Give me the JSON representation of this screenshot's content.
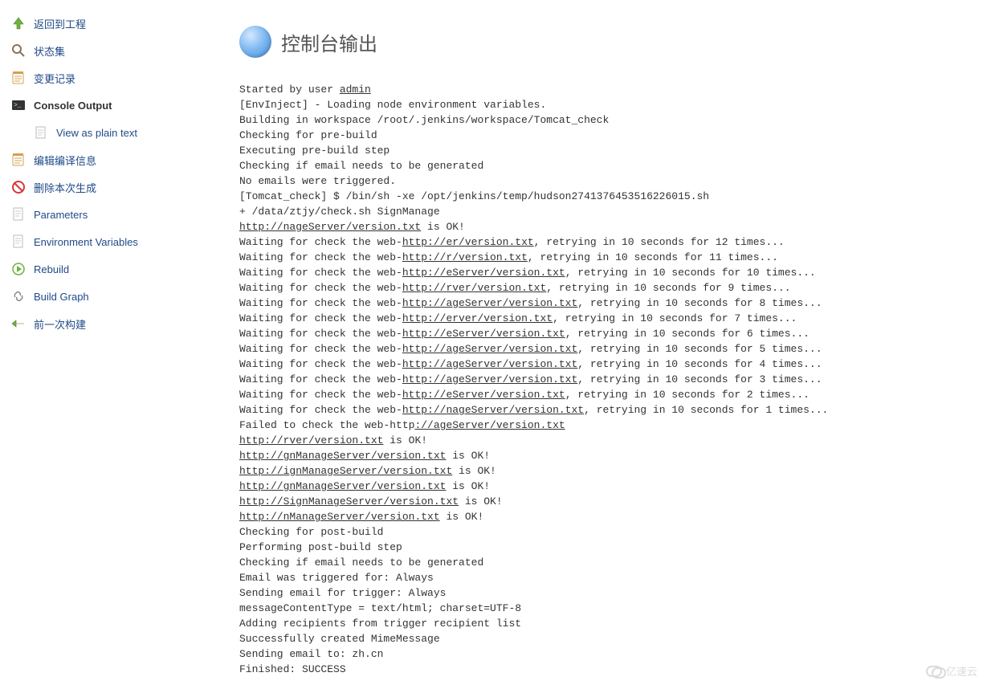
{
  "sidebar": {
    "items": [
      {
        "label": "返回到工程",
        "name": "back-to-project"
      },
      {
        "label": "状态集",
        "name": "status"
      },
      {
        "label": "变更记录",
        "name": "changes"
      },
      {
        "label": "Console Output",
        "name": "console-output",
        "active": true
      },
      {
        "label": "View as plain text",
        "name": "view-plain-text",
        "sub": true
      },
      {
        "label": "编辑编译信息",
        "name": "edit-build-info"
      },
      {
        "label": "删除本次生成",
        "name": "delete-build"
      },
      {
        "label": "Parameters",
        "name": "parameters"
      },
      {
        "label": "Environment Variables",
        "name": "env-vars"
      },
      {
        "label": "Rebuild",
        "name": "rebuild"
      },
      {
        "label": "Build Graph",
        "name": "build-graph"
      },
      {
        "label": "前一次构建",
        "name": "prev-build"
      }
    ]
  },
  "page": {
    "title": "控制台输出"
  },
  "console": {
    "started_by_prefix": "Started by user ",
    "started_by_user": "admin",
    "lines_pre": [
      "[EnvInject] - Loading node environment variables.",
      "Building in workspace /root/.jenkins/workspace/Tomcat_check",
      "Checking for pre-build",
      "Executing pre-build step",
      "Checking if email needs to be generated",
      "No emails were triggered.",
      "[Tomcat_check] $ /bin/sh -xe /opt/jenkins/temp/hudson2741376453516226015.sh",
      "+ /data/ztjy/check.sh SignManage"
    ],
    "first_ok": {
      "prefix": "http://",
      "blur": "                           ",
      "suffix": "nageServer/version.txt",
      "tail": " is OK!"
    },
    "wait_prefix": "Waiting for check the web-",
    "wait_url_prefix": "http://",
    "wait_rows": [
      {
        "blur": "                                         ",
        "suffix": "er/version.txt",
        "tail": ", retrying in 10 seconds for 12 times..."
      },
      {
        "blur": "                                          ",
        "suffix": "r/version.txt",
        "tail": ", retrying in 10 seconds for 11 times..."
      },
      {
        "blur": "                               ",
        "suffix": "eServer/version.txt",
        "tail": ", retrying in 10 seconds for 10 times..."
      },
      {
        "blur": "                                     ",
        "suffix": "rver/version.txt",
        "tail": ", retrying in 10 seconds for 9 times..."
      },
      {
        "blur": "                              ",
        "suffix": "ageServer/version.txt",
        "tail": ", retrying in 10 seconds for 8 times..."
      },
      {
        "blur": "                                 ",
        "suffix": "erver/version.txt",
        "tail": ", retrying in 10 seconds for 7 times..."
      },
      {
        "blur": "                               ",
        "suffix": "eServer/version.txt",
        "tail": ", retrying in 10 seconds for 6 times..."
      },
      {
        "blur": "                              ",
        "suffix": "ageServer/version.txt",
        "tail": ", retrying in 10 seconds for 5 times..."
      },
      {
        "blur": "                              ",
        "suffix": "ageServer/version.txt",
        "tail": ", retrying in 10 seconds for 4 times..."
      },
      {
        "blur": "                              ",
        "suffix": "ageServer/version.txt",
        "tail": ", retrying in 10 seconds for 3 times..."
      },
      {
        "blur": "                                ",
        "suffix": "eServer/version.txt",
        "tail": ", retrying in 10 seconds for 2 times..."
      },
      {
        "blur": "                             ",
        "suffix": "nageServer/version.txt",
        "tail": ", retrying in 10 seconds for 1 times..."
      }
    ],
    "failed": {
      "prefix": "Failed to check the web-http",
      "mid_prefix": "://",
      "blur": "                             ",
      "suffix": "ageServer/version.txt"
    },
    "ok_rows": [
      {
        "prefix": "http://",
        "blur": "                               ",
        "suffix": "rver/version.txt",
        "tail": " is OK!"
      },
      {
        "prefix": "http://",
        "blur": "                     ",
        "suffix": "gnManageServer/version.txt",
        "tail": " is OK!"
      },
      {
        "prefix": "http://",
        "blur": "                     ",
        "suffix": "ignManageServer/version.txt",
        "tail": " is OK!"
      },
      {
        "prefix": "http://",
        "blur": "                      ",
        "suffix": "gnManageServer/version.txt",
        "tail": " is OK!"
      },
      {
        "prefix": "http://",
        "blur": "                     ",
        "suffix": "SignManageServer/version.txt",
        "tail": " is OK!"
      },
      {
        "prefix": "http://",
        "blur": "                       ",
        "suffix": "nManageServer/version.txt",
        "tail": " is OK!"
      }
    ],
    "lines_post": [
      "Checking for post-build",
      "Performing post-build step",
      "Checking if email needs to be generated",
      "Email was triggered for: Always",
      "Sending email for trigger: Always",
      "messageContentType = text/html; charset=UTF-8",
      "Adding recipients from trigger recipient list",
      "Successfully created MimeMessage"
    ],
    "sending_email": {
      "prefix": "Sending email to: zh",
      "blur": "           ",
      "suffix": ".cn"
    },
    "finished": "Finished: SUCCESS"
  },
  "watermark": "亿速云"
}
